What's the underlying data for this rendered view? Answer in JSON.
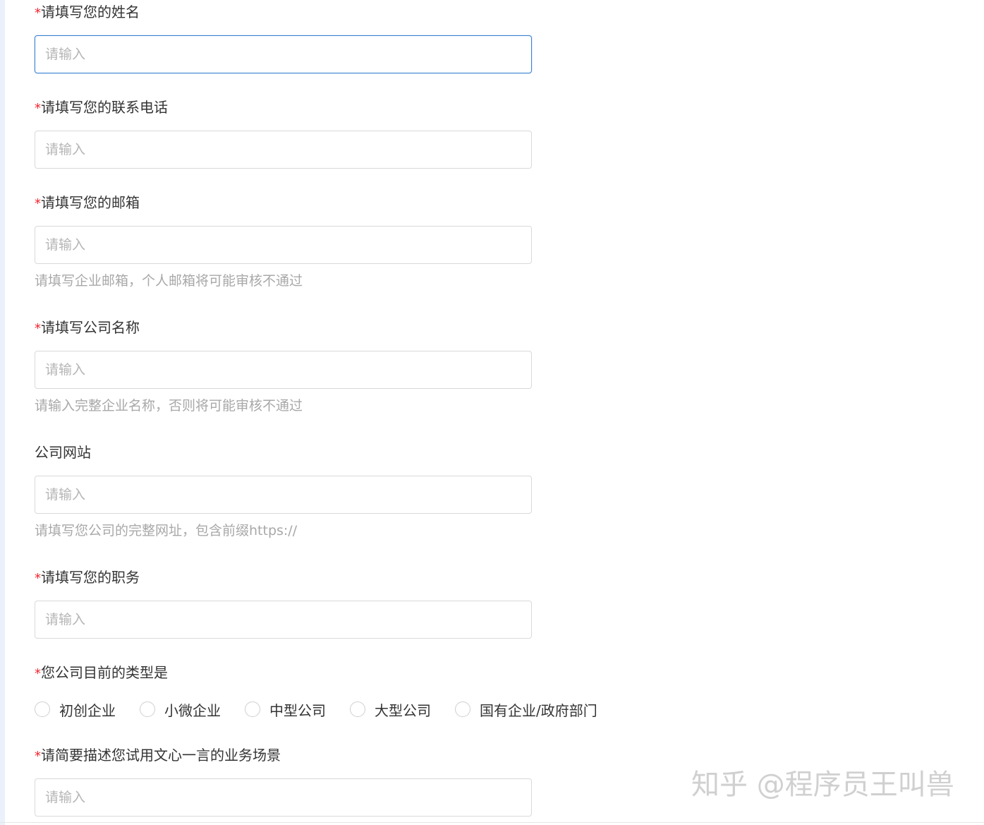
{
  "form": {
    "required_mark": "*",
    "fields": [
      {
        "label": "请填写您的姓名",
        "required": true,
        "placeholder": "请输入"
      },
      {
        "label": "请填写您的联系电话",
        "required": true,
        "placeholder": "请输入"
      },
      {
        "label": "请填写您的邮箱",
        "required": true,
        "placeholder": "请输入",
        "hint": "请填写企业邮箱，个人邮箱将可能审核不通过"
      },
      {
        "label": "请填写公司名称",
        "required": true,
        "placeholder": "请输入",
        "hint": "请输入完整企业名称，否则将可能审核不通过"
      },
      {
        "label": "公司网站",
        "required": false,
        "placeholder": "请输入",
        "hint": "请填写您公司的完整网址，包含前缀https://"
      },
      {
        "label": "请填写您的职务",
        "required": true,
        "placeholder": "请输入"
      }
    ],
    "company_type": {
      "label": "您公司目前的类型是",
      "required": true,
      "options": [
        "初创企业",
        "小微企业",
        "中型公司",
        "大型公司",
        "国有企业/政府部门"
      ]
    },
    "scenario": {
      "label": "请简要描述您试用文心一言的业务场景",
      "required": true,
      "placeholder": "请输入"
    }
  },
  "watermark": "知乎 @程序员王叫兽",
  "colors": {
    "required": "#f5222d",
    "focus_border": "#3c82d2",
    "placeholder": "#b5b5b5",
    "hint": "#a8a8a8"
  }
}
